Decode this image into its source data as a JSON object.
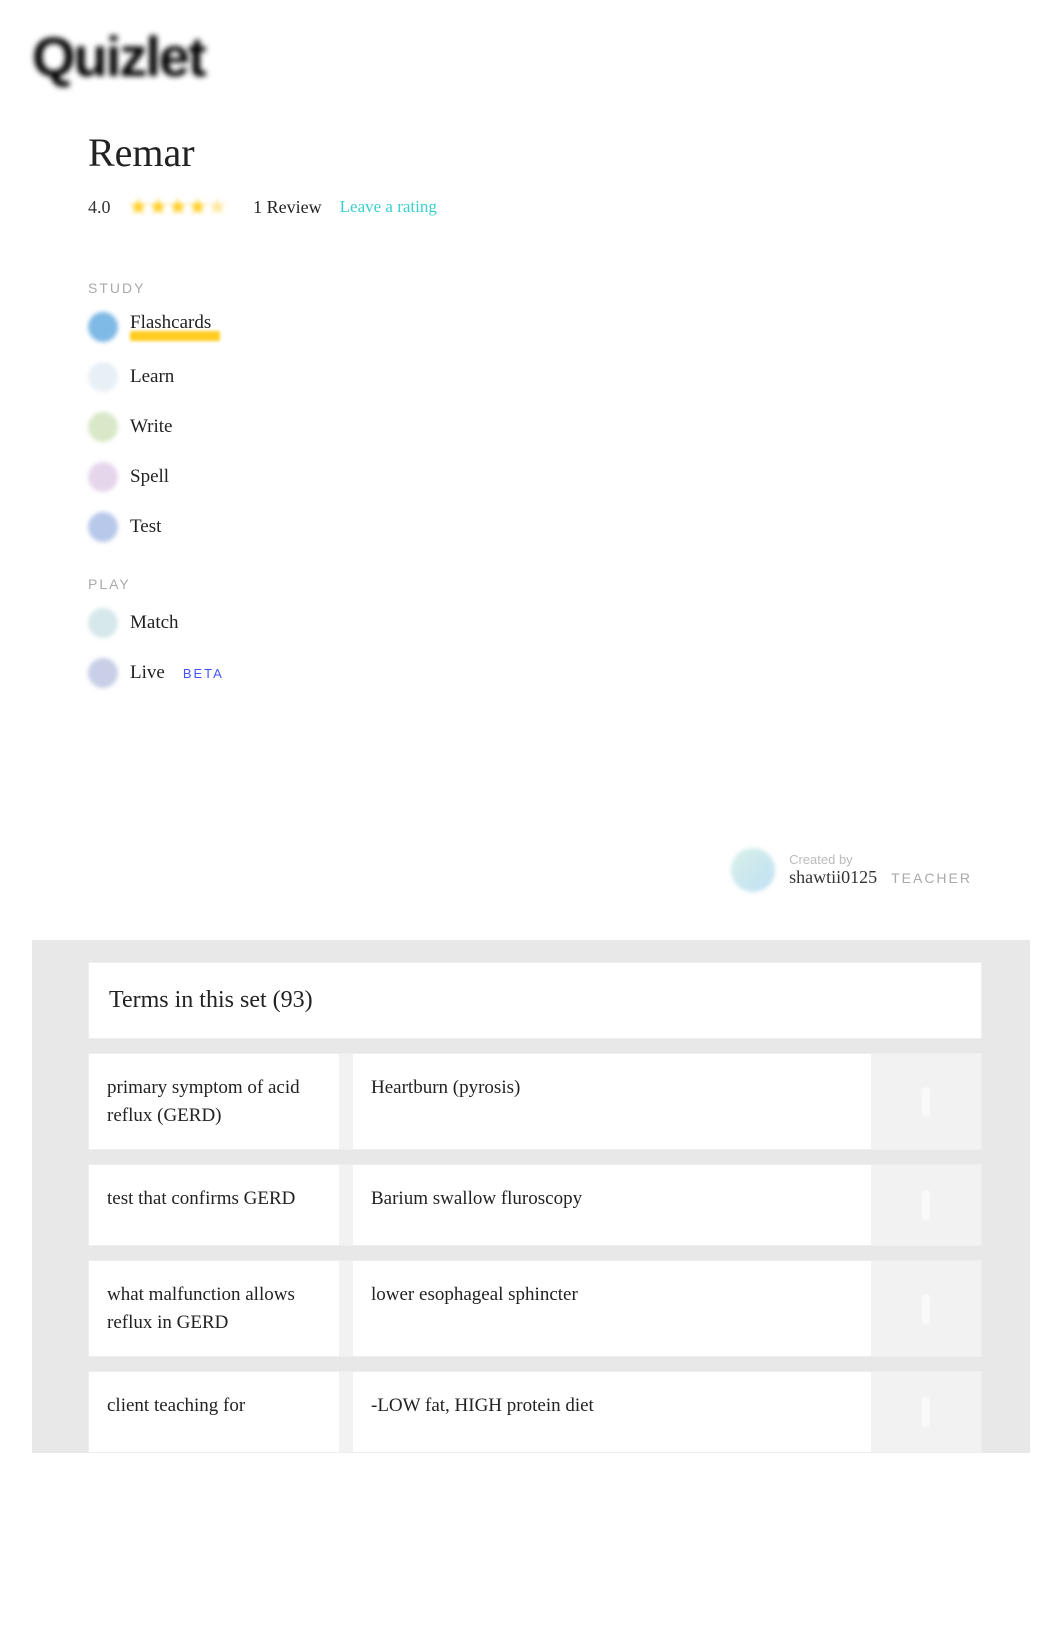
{
  "logo": "Quizlet",
  "title": "Remar",
  "rating": {
    "score": "4.0",
    "stars_full": 4,
    "review_count": "1 Review",
    "leave_label": "Leave a rating"
  },
  "sections": {
    "study_label": "STUDY",
    "play_label": "PLAY"
  },
  "modes": {
    "flashcards": "Flashcards",
    "learn": "Learn",
    "write": "Write",
    "spell": "Spell",
    "test": "Test",
    "match": "Match",
    "live": "Live",
    "beta": "BETA"
  },
  "mode_colors": {
    "flashcards": "#7fb9e6",
    "learn": "#e8f0f6",
    "write": "#d9e8c8",
    "spell": "#e6d6ec",
    "test": "#b8c8ea",
    "match": "#d6e8ea",
    "live": "#c8cfe6"
  },
  "creator": {
    "created_by": "Created by",
    "name": "shawtii0125",
    "teacher": "TEACHER"
  },
  "terms_header": "Terms in this set (93)",
  "terms": [
    {
      "term": "primary symptom of acid reflux (GERD)",
      "def": "Heartburn (pyrosis)"
    },
    {
      "term": "test that confirms GERD",
      "def": "Barium swallow fluroscopy"
    },
    {
      "term": "what malfunction allows reflux in GERD",
      "def": "lower esophageal sphincter"
    },
    {
      "term": "client teaching for",
      "def": "-LOW fat, HIGH protein diet"
    }
  ]
}
